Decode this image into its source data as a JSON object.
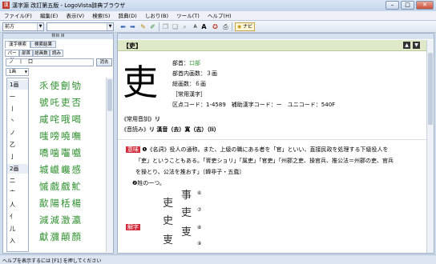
{
  "window": {
    "title": "漢字源 改訂第五版 - LogoVista辞典ブラウザ",
    "minimize": "–",
    "maximize": "□",
    "close": "✕"
  },
  "menu": [
    "ファイル(F)",
    "編集(E)",
    "表示(V)",
    "検索(S)",
    "辞典(D)",
    "しおり(B)",
    "ツール(T)",
    "ヘルプ(H)"
  ],
  "toolbar": {
    "search_mode": "前方",
    "search_value": "",
    "navi_label": "ナビ"
  },
  "left": {
    "header": "検目  目",
    "tabs": [
      "漢字検索",
      "検索結果"
    ],
    "subtabs": [
      "パーツ",
      "部首",
      "総画数",
      "読み"
    ],
    "parts_input": "ノ　丨　口",
    "clear_button": "消去",
    "stroke_select": "1画",
    "stroke_items": [
      "1画",
      "一",
      "丨",
      "丶",
      "ノ",
      "乙",
      "亅",
      "2画",
      "二",
      "亠",
      "人",
      "亻",
      "儿",
      "入"
    ],
    "kanji_rows": [
      "乑使劊劬",
      "號吒吏否",
      "咸咤哦喝",
      "嗤嗙嘵嘸",
      "嘺噛囓嚱",
      "城巇巉感",
      "慽戲戲䰶",
      "歃陽栝楊",
      "減減澂瀛",
      "獻瀰顛顏"
    ]
  },
  "entry": {
    "header": "【吏】",
    "character": "吏",
    "radical_label": "部首：",
    "radical_value": "口部",
    "inner_strokes": "部首内画数：３画",
    "total_strokes": "総画数：６画",
    "joyo": "［常用漢字］",
    "codes": "区点コード：1-4589　補助漢字コード：ー　ユニコード：540F",
    "on_reading_label": "《常用音訓》",
    "on_reading": "リ",
    "readings_label": "《音読み》",
    "readings": "リ 漢音（去）寘（志）（li）",
    "meaning_label": "意味",
    "meaning_line1": "❶《名詞》役人の通称。また、上級の職にある者を「官」といい、直接民政を処理する下級役人を",
    "meaning_line2": "「吏」ということもある。「胥吏ショリ」「属吏」「官吏」「州郡之吏、操官兵、推公法＝州郡の吏、官兵",
    "meaning_line3": "を操とり、公法を推おす」〔韓非子・五蠹〕",
    "meaning_line4": "❷姓の一つ。",
    "kaiji_label": "解字",
    "glyph_marks": [
      "⑥",
      "⑦",
      "⑧",
      "⑨"
    ]
  },
  "status": "ヘルプを表示するには [F1] を押してください"
}
